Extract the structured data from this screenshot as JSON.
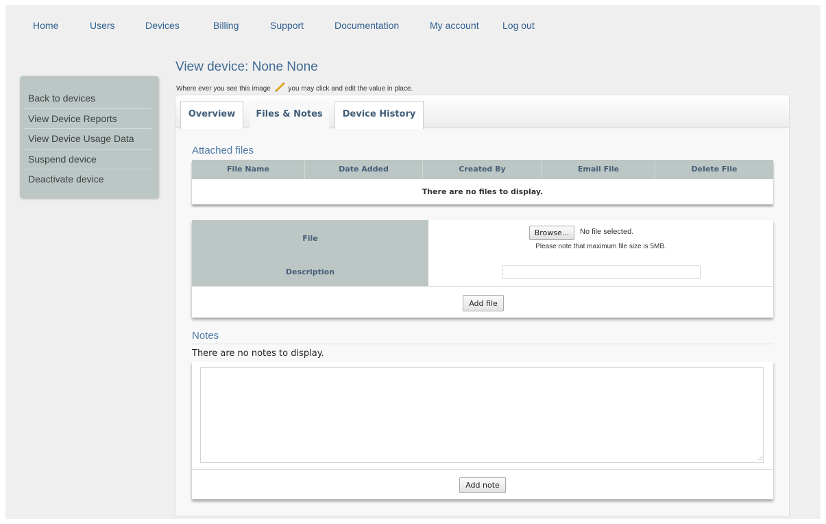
{
  "nav": {
    "items": [
      "Home",
      "Users",
      "Devices",
      "Billing",
      "Support",
      "Documentation",
      "My account",
      "Log out"
    ]
  },
  "sidebar": {
    "items": [
      "Back to devices",
      "View Device Reports",
      "View Device Usage Data",
      "Suspend device",
      "Deactivate device"
    ]
  },
  "page": {
    "title": "View device: None None",
    "hint_before": "Where ever you see this image",
    "hint_after": "you may click and edit the value in place.",
    "pencil_icon": "pencil-icon"
  },
  "tabs": [
    {
      "label": "Overview",
      "active": false
    },
    {
      "label": "Files & Notes",
      "active": true
    },
    {
      "label": "Device History",
      "active": false
    }
  ],
  "files": {
    "section_title": "Attached files",
    "columns": [
      "File Name",
      "Date Added",
      "Created By",
      "Email File",
      "Delete File"
    ],
    "empty_message": "There are no files to display."
  },
  "upload": {
    "file_label": "File",
    "description_label": "Description",
    "browse_label": "Browse...",
    "file_status": "No file selected.",
    "size_note": "Please note that maximum file size is 5MB.",
    "description_value": "",
    "submit_label": "Add file"
  },
  "notes": {
    "section_title": "Notes",
    "empty_message": "There are no notes to display.",
    "note_value": "",
    "submit_label": "Add note"
  },
  "colors": {
    "link": "#2f5f8f",
    "title": "#3f6a95",
    "header_bg": "#bcc6c4",
    "page_bg": "#efefef"
  }
}
